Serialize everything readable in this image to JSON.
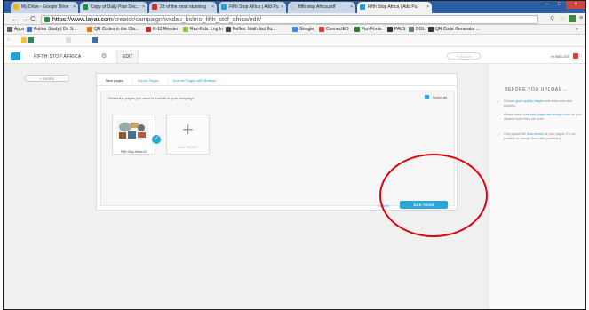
{
  "browser": {
    "tabs": [
      {
        "title": "My Drive - Google Drive",
        "fav_color": "#f4b400"
      },
      {
        "title": "Copy of Daily Plan Dec..",
        "fav_color": "#1e8e3e"
      },
      {
        "title": "28 of the most stunning",
        "fav_color": "#d93025"
      },
      {
        "title": "Fifth Stop Africa | Add Pu",
        "fav_color": "#24a0d8"
      },
      {
        "title": "fifth stop Africa.pdf",
        "fav_color": "#cccccc"
      },
      {
        "title": "Fifth Stop Africa | Add Pu",
        "fav_color": "#24a0d8"
      }
    ],
    "url_host": "https://www.layar.com",
    "url_path": "/creator/campaign/wxdau_bslmo_fifth_stof_africa/edit/",
    "bookmarks": [
      {
        "label": "Apps",
        "color": "#5f6368"
      },
      {
        "label": "Author Study | Dr. S...",
        "color": "#3c6fd1"
      },
      {
        "label": "QR Codes in the Cla...",
        "color": "#e8710a"
      },
      {
        "label": "K-12 Reader",
        "color": "#c62828"
      },
      {
        "label": "Raz-Kids: Log In",
        "color": "#8bc34a"
      },
      {
        "label": "Reflex: Math fact flu...",
        "color": "#444444"
      },
      {
        "label": "Google",
        "color": "#4285f4"
      },
      {
        "label": "ConnectED",
        "color": "#e53935"
      },
      {
        "label": "Fun Fonts",
        "color": "#2e7d32"
      },
      {
        "label": "PALS",
        "color": "#333333"
      },
      {
        "label": "DOL",
        "color": "#607d8b"
      },
      {
        "label": "QR Code Generator ...",
        "color": "#333333"
      }
    ]
  },
  "app": {
    "campaign_name": "FIFTH STOP AFRICA",
    "edit_tab": "EDIT",
    "publish_label": "PUBLISH",
    "user_label": "Hi BELLIST",
    "pages_button": "+ PAGES"
  },
  "dialog": {
    "tabs": [
      "New pages",
      "Import Pages",
      "Include Pages with Buttons"
    ],
    "instruction": "Select the pages you want to include in your campaign",
    "select_all": "Select all",
    "thumb_label": "Fifth Stop Africa #1",
    "add_pages_label": "ADD PAGES",
    "cancel_label": "Cancel",
    "add_page_button": "ADD PAGE"
  },
  "sidebar": {
    "title": "BEFORE YOU UPLOAD...",
    "tips": [
      {
        "pre": "Choose ",
        "hl": "good quality images",
        "post": " with clear lines and textures."
      },
      {
        "pre": "Please make sure ",
        "hl": "each page has enough color",
        "post": " so your viewers know they can scan."
      },
      {
        "pre": "Only upload the ",
        "hl": "final version",
        "post": " of your pages. It's not possible to change them after publishing."
      }
    ]
  },
  "colors": {
    "accent": "#2aa7d9",
    "annotation": "#e3000f"
  }
}
